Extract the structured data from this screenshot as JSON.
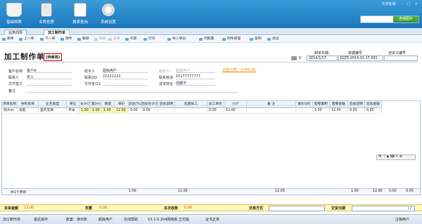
{
  "header": {
    "modules": [
      {
        "label": "基础档案",
        "icon": "basket-icon"
      },
      {
        "label": "业务处理",
        "icon": "calculator-icon"
      },
      {
        "label": "报表查询",
        "icon": "chart-icon"
      },
      {
        "label": "系统设置",
        "icon": "gear-icon"
      }
    ],
    "window_label": "在线客服",
    "search_placeholder": "",
    "search_button": "连接图片"
  },
  "tabs": [
    {
      "label": "业务向导"
    },
    {
      "label": "加工制作单"
    }
  ],
  "toolbar": [
    {
      "label": "新单",
      "enabled": true
    },
    {
      "label": "上一单",
      "enabled": true
    },
    {
      "label": "下一单",
      "enabled": true
    },
    {
      "label": "保存",
      "enabled": true
    },
    {
      "label": "删除",
      "enabled": true
    },
    {
      "label": "审核",
      "enabled": false
    },
    {
      "label": "反审",
      "enabled": false
    },
    {
      "label": "作废",
      "enabled": true
    },
    {
      "label": "打印",
      "enabled": true
    },
    {
      "label": "导入导出",
      "enabled": true
    },
    {
      "label": "列配置",
      "enabled": true
    },
    {
      "label": "附件管理",
      "enabled": true
    },
    {
      "label": "复制",
      "enabled": true
    },
    {
      "label": "退出",
      "enabled": true
    }
  ],
  "doc": {
    "title": "加工制作单",
    "status": "(待审核)",
    "print_count": "0",
    "date_label": "制单日期",
    "date_value": "2014/1/17",
    "docno_label": "单据编号",
    "docno_value": "JGZD-2014-01-17-001",
    "custom_label": "自定义编号",
    "custom_value": ""
  },
  "form": {
    "customer_label": "客户名称",
    "customer_value": "客户A",
    "contact_label": "联系人",
    "contact_value": "张三",
    "file_sign_label": "文件签订",
    "remark_label": "备注",
    "handler_label": "经手人",
    "handler_value": "超级用户",
    "qq_label": "联系QQ",
    "qq_value": "22222222",
    "file_sign2_label": "文件签订2",
    "maker_label": "制单人",
    "maker_value": "超级用户",
    "phone_label": "联系电话",
    "phone_value": "15177777777",
    "address_label": "送货地址",
    "address_value": "成都市",
    "link_text": "当前欠款：1584.00"
  },
  "grid": {
    "columns": [
      "项目名称",
      "材料名称",
      "业务类型",
      "单位",
      "长(m)",
      "宽(m)",
      "数量",
      "单价",
      "后加(%)",
      "后加合计(元)",
      "后加说明",
      "后期加工",
      "加工单价",
      "小计",
      "备 注",
      "报价(折)",
      "图卷面积",
      "图卷金额",
      "后加说明",
      "后加金额"
    ],
    "rows": [
      [
        "喷大vc",
        "背胶",
        "室内写真",
        "平米",
        "1.00",
        "1.00",
        "1.00",
        "12.00",
        "0.00",
        "0.00",
        "",
        "",
        "0.00",
        "12.00",
        "",
        "",
        "1.00",
        "12.00",
        "0.00",
        "0.00"
      ]
    ],
    "summary": {
      "count": "共1个项目",
      "qty": "1.00",
      "amount": "12.00",
      "subtotal": "12.00",
      "area": "1.00",
      "area_amount": "12.00",
      "p1": "0.00",
      "p2": "0.00"
    }
  },
  "ime_bar": "中 ☽ ◉ ⌨ ✎ ⚙",
  "totals": {
    "amount_label": "本单金额",
    "amount_value": "12.00",
    "discount_label": "优惠",
    "discount_value": "0.00",
    "received_label": "本次收款",
    "received_value": "0.00",
    "pay_label": "交易方式",
    "date_label": "交货日期",
    "date_value": "/ /"
  },
  "statusbar": {
    "items": [
      "加工制作单",
      "最近操作",
      "账套：演示账",
      "超级用户",
      "在线帮助",
      "V2.1.0.204网络版  正式版",
      "证书正常"
    ],
    "logout": "注销用户"
  }
}
